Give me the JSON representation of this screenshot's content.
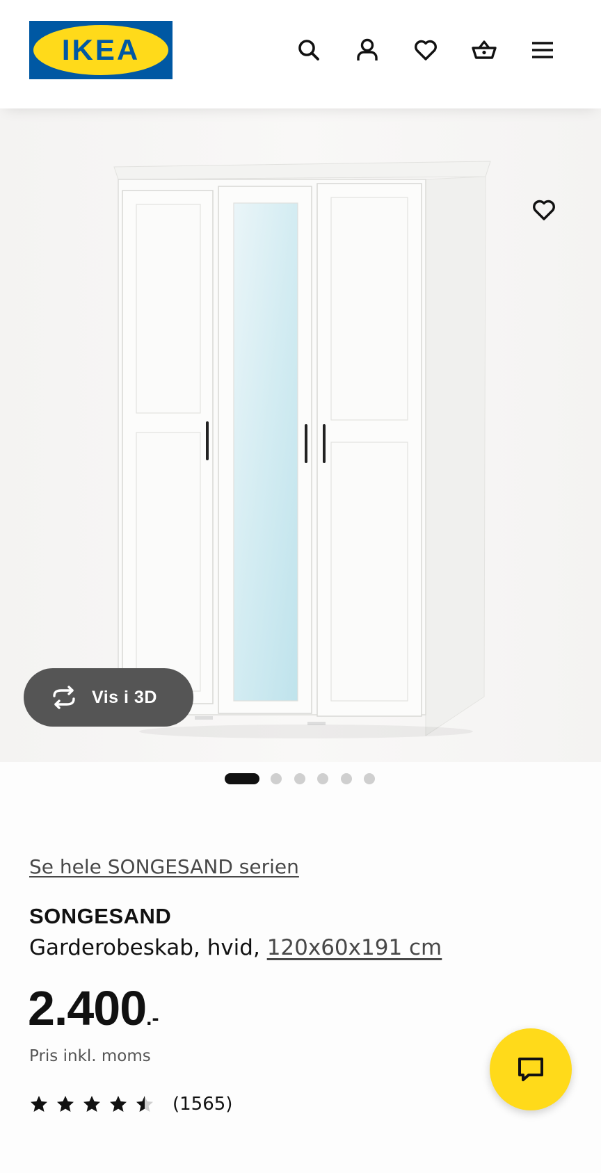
{
  "header": {
    "logo_text": "IKEA",
    "icons": [
      "search-icon",
      "profile-icon",
      "favourites-icon",
      "basket-icon",
      "menu-icon"
    ]
  },
  "gallery": {
    "favourite_icon": "heart-icon",
    "view_3d_label": "Vis i 3D",
    "view_3d_icon": "rotate-3d-icon",
    "image_count": 6,
    "active_index": 0
  },
  "product": {
    "series_link": "Se hele SONGESAND serien",
    "name": "SONGESAND",
    "description": "Garderobeskab, hvid, ",
    "dimensions": "120x60x191 cm",
    "price": "2.400",
    "price_suffix": ".-",
    "price_note": "Pris inkl. moms",
    "rating": 4.5,
    "rating_max": 5,
    "review_count": "(1565)"
  },
  "chat": {
    "icon": "chat-icon"
  },
  "colors": {
    "ikea_blue": "#0058a3",
    "ikea_yellow": "#ffda1a",
    "text_primary": "#111111",
    "text_secondary": "#484848",
    "pill_dark": "#555555"
  }
}
